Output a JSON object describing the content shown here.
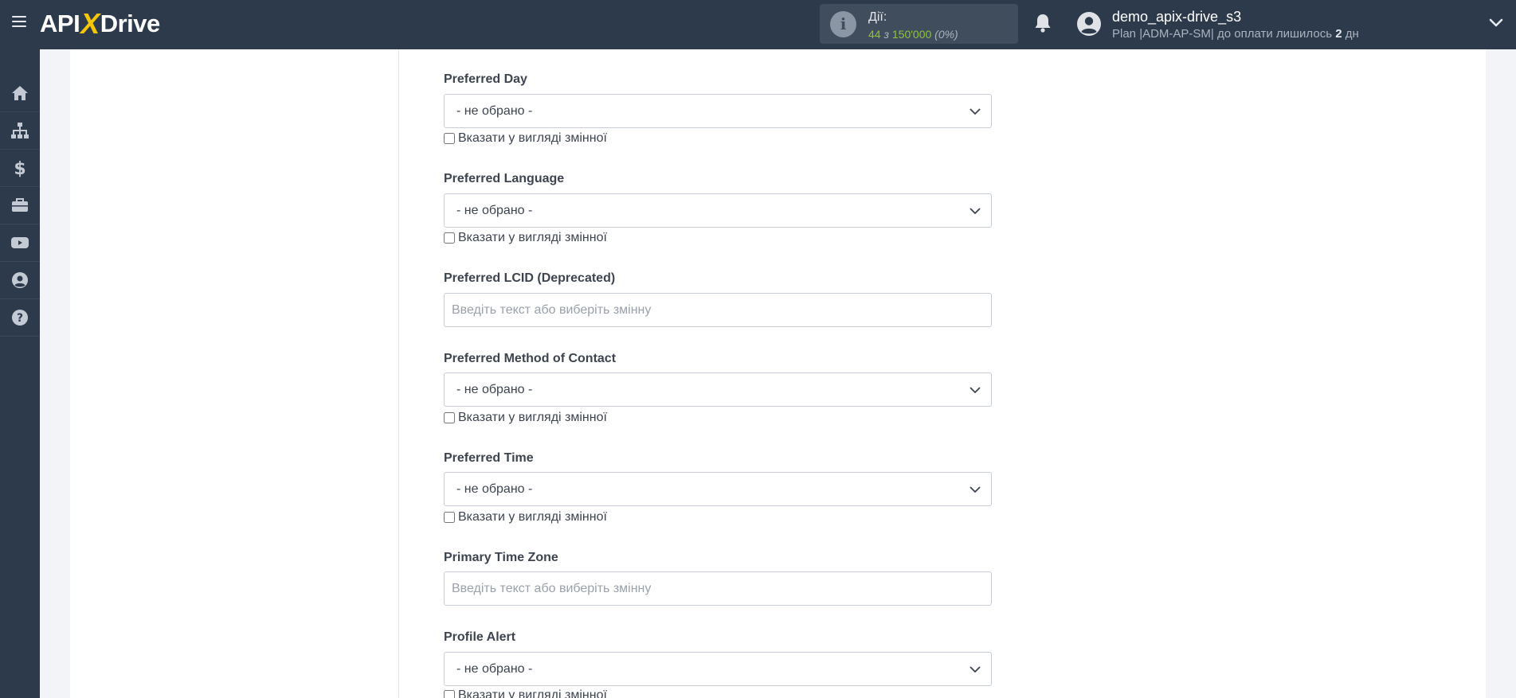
{
  "topbar": {
    "logo": {
      "left": "API",
      "x": "X",
      "right": "Drive"
    },
    "actions": {
      "title": "Дії:",
      "used": "44",
      "separator": "з",
      "limit": "150'000",
      "percent": "(0%)"
    },
    "user": {
      "name": "demo_apix-drive_s3",
      "plan_prefix": "Plan |ADM-AP-SM| до оплати лишилось",
      "days": "2",
      "days_suffix": "дн"
    }
  },
  "sidebar": {
    "items": [
      {
        "icon": "home-icon"
      },
      {
        "icon": "sitemap-icon"
      },
      {
        "icon": "dollar-icon"
      },
      {
        "icon": "briefcase-icon"
      },
      {
        "icon": "youtube-icon"
      },
      {
        "icon": "user-circle-icon"
      },
      {
        "icon": "question-circle-icon"
      }
    ]
  },
  "form": {
    "fields": [
      {
        "label": "Preferred Day",
        "type": "select",
        "value": "- не обрано -",
        "checkbox": "Вказати у вигляді змінної"
      },
      {
        "label": "Preferred Language",
        "type": "select",
        "value": "- не обрано -",
        "checkbox": "Вказати у вигляді змінної"
      },
      {
        "label": "Preferred LCID (Deprecated)",
        "type": "text",
        "placeholder": "Введіть текст або виберіть змінну"
      },
      {
        "label": "Preferred Method of Contact",
        "type": "select",
        "value": "- не обрано -",
        "checkbox": "Вказати у вигляді змінної"
      },
      {
        "label": "Preferred Time",
        "type": "select",
        "value": "- не обрано -",
        "checkbox": "Вказати у вигляді змінної"
      },
      {
        "label": "Primary Time Zone",
        "type": "text",
        "placeholder": "Введіть текст або виберіть змінну"
      },
      {
        "label": "Profile Alert",
        "type": "select",
        "value": "- не обрано -",
        "checkbox": "Вказати у вигляді змінної"
      }
    ]
  },
  "colors": {
    "topbar": "#2d3a4b",
    "accent_yellow": "#f6c600",
    "count_green": "#8fc33e",
    "page_bg": "#f3f4f8"
  }
}
